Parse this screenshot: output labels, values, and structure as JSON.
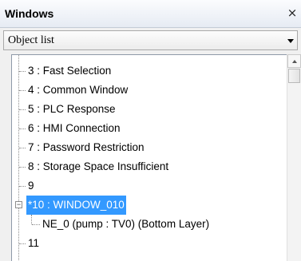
{
  "window": {
    "title": "Windows",
    "close_glyph": "×"
  },
  "object_selector": {
    "value": "Object list"
  },
  "tree": {
    "items": [
      {
        "label": "3 : Fast Selection"
      },
      {
        "label": "4 : Common Window"
      },
      {
        "label": "5 : PLC Response"
      },
      {
        "label": "6 : HMI Connection"
      },
      {
        "label": "7 : Password Restriction"
      },
      {
        "label": "8 : Storage Space Insufficient"
      },
      {
        "label": "9"
      },
      {
        "label": "*10 : WINDOW_010",
        "selected": true,
        "expanded": true
      },
      {
        "label": "NE_0 (pump : TV0) (Bottom Layer)",
        "child": true
      },
      {
        "label": "11"
      }
    ]
  },
  "icons": {
    "close": "close-icon",
    "dropdown": "chevron-down-icon",
    "expander": "collapse-icon",
    "scroll_up": "scroll-up-arrow-icon"
  }
}
